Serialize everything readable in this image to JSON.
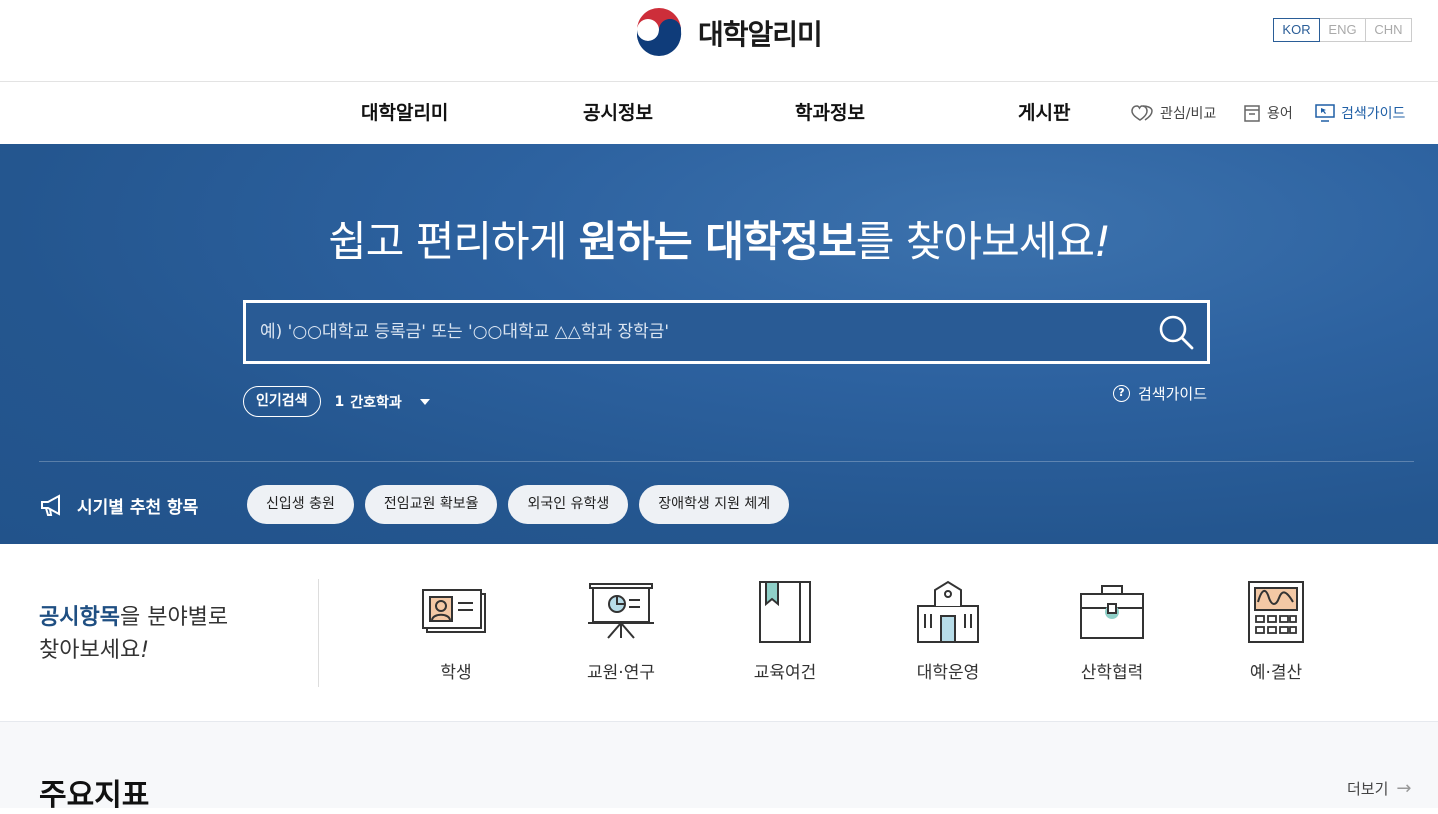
{
  "header": {
    "logo_text": "대학알리미",
    "languages": [
      "KOR",
      "ENG",
      "CHN"
    ],
    "active_language": "KOR"
  },
  "nav": {
    "items": [
      "대학알리미",
      "공시정보",
      "학과정보",
      "게시판"
    ],
    "utils": [
      {
        "label": "관심/비교",
        "icon": "heart-compare-icon"
      },
      {
        "label": "용어",
        "icon": "glossary-icon"
      },
      {
        "label": "검색가이드",
        "icon": "monitor-guide-icon"
      }
    ]
  },
  "hero": {
    "title_part1": "쉽고 편리하게 ",
    "title_bold": "원하는 대학정보",
    "title_part2": "를 찾아보세요",
    "title_end": "!",
    "search_placeholder": "예) '○○대학교 등록금' 또는 '○○대학교 △△학과 장학금'",
    "popular_label": "인기검색",
    "popular_rank": "1",
    "popular_term": "간호학과",
    "guide_label": "검색가이드",
    "recommend_label": "시기별 추천 항목",
    "chips": [
      "신입생 충원",
      "전임교원 확보율",
      "외국인 유학생",
      "장애학생 지원 체계"
    ]
  },
  "categories": {
    "intro_bold": "공시항목",
    "intro_rest": "을 분야별로",
    "intro_line2": "찾아보세요",
    "intro_end": "!",
    "items": [
      {
        "label": "학생",
        "icon": "student-id-icon"
      },
      {
        "label": "교원·연구",
        "icon": "presentation-icon"
      },
      {
        "label": "교육여건",
        "icon": "book-icon"
      },
      {
        "label": "대학운영",
        "icon": "building-icon"
      },
      {
        "label": "산학협력",
        "icon": "briefcase-icon"
      },
      {
        "label": "예·결산",
        "icon": "calculator-icon"
      }
    ]
  },
  "main": {
    "title": "주요지표",
    "more_label": "더보기"
  },
  "colors": {
    "brand_blue": "#2a5d97",
    "hero_bg": "#2d62a0",
    "accent_text": "#1f4f82"
  }
}
